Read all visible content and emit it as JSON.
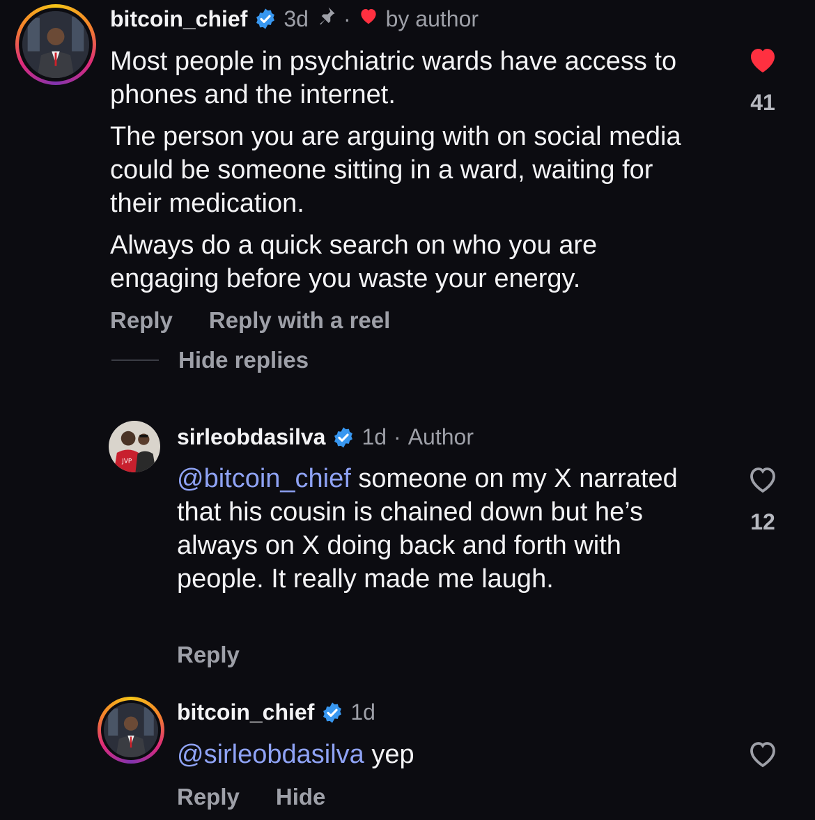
{
  "comments": [
    {
      "username": "bitcoin_chief",
      "time": "3d",
      "pin": "pin-icon",
      "dot": "·",
      "author_like_label": "by author",
      "paragraphs": [
        "Most people in psychiatric wards have access to phones and the internet.",
        "The person you are arguing with on social media could be someone sitting in a ward, waiting for their medication.",
        "Always do a quick search on who you are engaging before you waste your energy."
      ],
      "actions": [
        "Reply",
        "Reply with a reel"
      ],
      "likes": "41",
      "liked": true
    },
    {
      "username": "sirleobdasilva",
      "time": "1d",
      "dot": "·",
      "badge": "Author",
      "mention": "@bitcoin_chief",
      "text": " someone on my X narrated that his cousin is chained down but he’s always on X doing back and forth with people. It really made me laugh.",
      "actions": [
        "Reply"
      ],
      "likes": "12",
      "liked": false
    },
    {
      "username": "bitcoin_chief",
      "time": "1d",
      "mention": "@sirleobdasilva",
      "text": " yep",
      "actions": [
        "Reply",
        "Hide"
      ],
      "liked": false
    }
  ],
  "hide_replies_label": "Hide replies",
  "colors": {
    "background": "#0c0c11",
    "verified": "#3897f0",
    "like_red": "#ff3040",
    "mention": "#8fa3f5",
    "muted": "#9ea0a8"
  }
}
